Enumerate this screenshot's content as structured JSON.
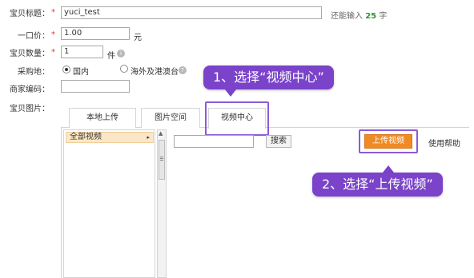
{
  "form": {
    "title_label": "宝贝标题：",
    "title_value": "yuci_test",
    "title_hint_prefix": "还能输入",
    "title_hint_count": "25",
    "title_hint_suffix": "字",
    "price_label": "一口价：",
    "price_value": "1.00",
    "price_unit": "元",
    "qty_label": "宝贝数量：",
    "qty_value": "1",
    "qty_unit": "件",
    "purchase_label": "采购地：",
    "purchase_options": [
      "国内",
      "海外及港澳台"
    ],
    "purchase_selected": "国内",
    "merchant_code_label": "商家编码：",
    "merchant_code_value": "",
    "images_label": "宝贝图片：",
    "required_mark": "*"
  },
  "tabs": [
    {
      "label": "本地上传",
      "active": false
    },
    {
      "label": "图片空间",
      "active": false
    },
    {
      "label": "视频中心",
      "active": true
    }
  ],
  "video_center": {
    "tree_item": "全部视频",
    "search_value": "",
    "search_button": "搜索",
    "upload_button": "上传视频",
    "help_link": "使用帮助"
  },
  "callouts": {
    "step1": "1、选择“视频中心”",
    "step2": "2、选择“上传视频”"
  },
  "colors": {
    "callout": "#7a43c9",
    "highlight": "#8b5bd6",
    "upload_button": "#f08a24",
    "required": "#e0382a",
    "count": "#2a9a2a"
  }
}
